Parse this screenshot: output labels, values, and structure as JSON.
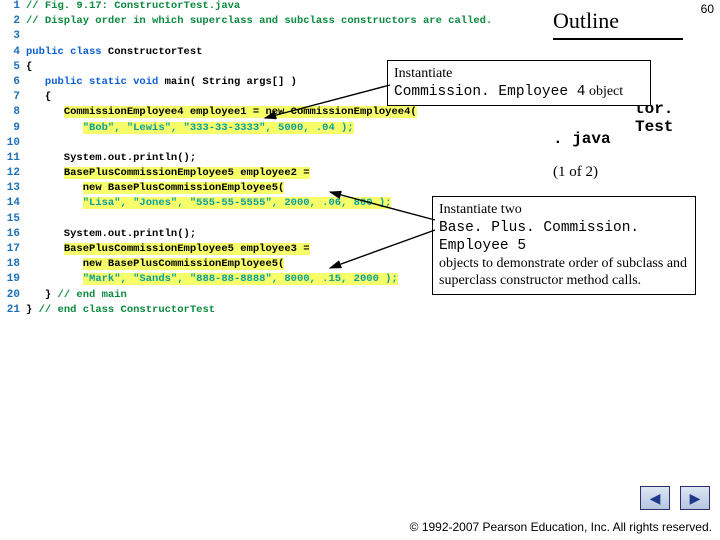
{
  "page_number": "60",
  "outline_heading": "Outline",
  "right_labels": {
    "tor_test": "tor. Test",
    "java": ". java",
    "page_of": "(1 of 2)"
  },
  "callout1": {
    "line1": "Instantiate",
    "code": "Commission. Employee 4",
    "tail": " object"
  },
  "callout2": {
    "line1": "Instantiate two",
    "code": "Base. Plus. Commission. Employee 5",
    "line3": "objects to demonstrate order of subclass and superclass constructor method calls."
  },
  "nav": {
    "prev": "◀",
    "next": "▶"
  },
  "footer": "© 1992-2007 Pearson Education, Inc.  All rights reserved.",
  "code": {
    "l1": {
      "n": "1",
      "cm": "// Fig. 9.17: ConstructorTest.java"
    },
    "l2": {
      "n": "2",
      "cm": "// Display order in which superclass and subclass constructors are called."
    },
    "l3": {
      "n": "3",
      "txt": ""
    },
    "l4": {
      "n": "4",
      "a": "public class",
      "b": " ConstructorTest"
    },
    "l5": {
      "n": "5",
      "txt": "{"
    },
    "l6": {
      "n": "6",
      "a": "   public static void",
      "b": " main( String args[] )"
    },
    "l7": {
      "n": "7",
      "txt": "   {"
    },
    "l8": {
      "n": "8",
      "pre": "      ",
      "hl": "CommissionEmployee4 employee1 = new CommissionEmployee4(",
      "post": ""
    },
    "l9": {
      "n": "9",
      "pre": "         ",
      "str": "\"Bob\", \"Lewis\", \"333-33-3333\", 5000, .04 );",
      "hlend": ""
    },
    "l10": {
      "n": "10",
      "txt": ""
    },
    "l11": {
      "n": "11",
      "txt": "      System.out.println();"
    },
    "l12": {
      "n": "12",
      "pre": "      ",
      "hl": "BasePlusCommissionEmployee5 employee2 ="
    },
    "l13": {
      "n": "13",
      "pre": "         ",
      "hl": "new BasePlusCommissionEmployee5("
    },
    "l14": {
      "n": "14",
      "pre": "         ",
      "str": "\"Lisa\", \"Jones\", \"555-55-5555\", 2000, .06, 800 );"
    },
    "l15": {
      "n": "15",
      "txt": ""
    },
    "l16": {
      "n": "16",
      "txt": "      System.out.println();"
    },
    "l17": {
      "n": "17",
      "pre": "      ",
      "hl": "BasePlusCommissionEmployee5 employee3 ="
    },
    "l18": {
      "n": "18",
      "pre": "         ",
      "hl": "new BasePlusCommissionEmployee5("
    },
    "l19": {
      "n": "19",
      "pre": "         ",
      "str": "\"Mark\", \"Sands\", \"888-88-8888\", 8000, .15, 2000 );"
    },
    "l20": {
      "n": "20",
      "a": "   }",
      "cm": " // end main"
    },
    "l21": {
      "n": "21",
      "a": "}",
      "cm": " // end class ConstructorTest"
    }
  }
}
